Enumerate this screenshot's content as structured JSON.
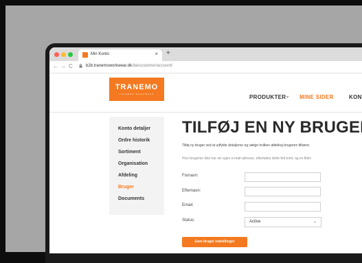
{
  "browser": {
    "tab_title": "Min Konto",
    "tab_close": "×",
    "new_tab": "+",
    "nav_back": "←",
    "nav_forward": "→",
    "nav_reload": "C",
    "url_host": "b2b.tranemoworkwear.dk",
    "url_path": "/da/customer/account/"
  },
  "header": {
    "logo_name": "TRANEMO",
    "logo_tagline": "TRANEMO WORKWEAR",
    "nav": {
      "produkter": "PRODUKTER",
      "produkter_chevron": "⌄",
      "mine_sider": "MINE SIDER",
      "kontakt": "KONT"
    }
  },
  "sidebar": {
    "items": [
      {
        "label": "Konto detaljer"
      },
      {
        "label": "Ordre historik"
      },
      {
        "label": "Sortiment"
      },
      {
        "label": "Organisation"
      },
      {
        "label": "Afdeling"
      },
      {
        "label": "Bruger"
      },
      {
        "label": "Documents"
      }
    ]
  },
  "main": {
    "title": "TILFØJ EN NY BRUGER",
    "description": "Tilføj ny bruger ved at udfylde detaljerne og vælge hvilken afdeling brugeren tilhører.",
    "note": "Hvis brugeren ikke har sin egen e-mail-adresse, efterlades dette felt tomt, og en fiktiv",
    "fields": {
      "fornavn": {
        "label": "Fornavn:",
        "value": ""
      },
      "efternavn": {
        "label": "Efternavn:",
        "value": ""
      },
      "email": {
        "label": "Email:",
        "value": ""
      },
      "status": {
        "label": "Status:",
        "value": "Active",
        "chevron": "⌄"
      }
    },
    "save_button": "Gem bruger indstillinger"
  },
  "colors": {
    "accent": "#f47920",
    "text": "#333333"
  }
}
